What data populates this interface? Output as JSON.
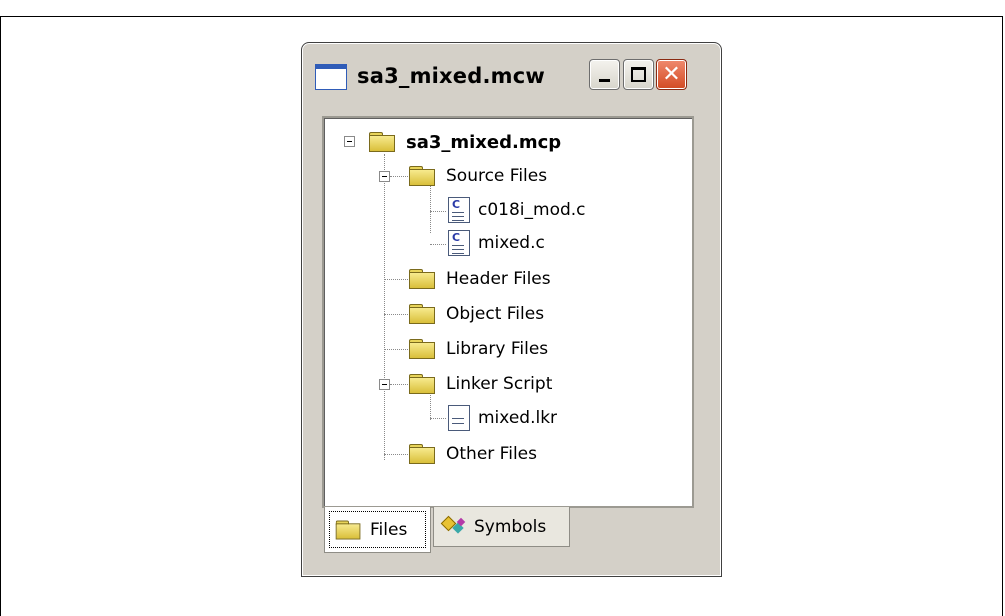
{
  "window": {
    "title": "sa3_mixed.mcw",
    "close_glyph": "✕"
  },
  "tree": {
    "project": "sa3_mixed.mcp",
    "source_files": "Source Files",
    "file_1": "c018i_mod.c",
    "file_2": "mixed.c",
    "header_files": "Header Files",
    "object_files": "Object Files",
    "library_files": "Library Files",
    "linker_script": "Linker Script",
    "file_3": "mixed.lkr",
    "other_files": "Other Files",
    "c_file_glyph": "C"
  },
  "tabs": {
    "files": "Files",
    "symbols": "Symbols"
  },
  "colors": {
    "folder": "#e8d45a",
    "title_close": "#d24a23",
    "app_icon_blue": "#2f5cb8"
  }
}
